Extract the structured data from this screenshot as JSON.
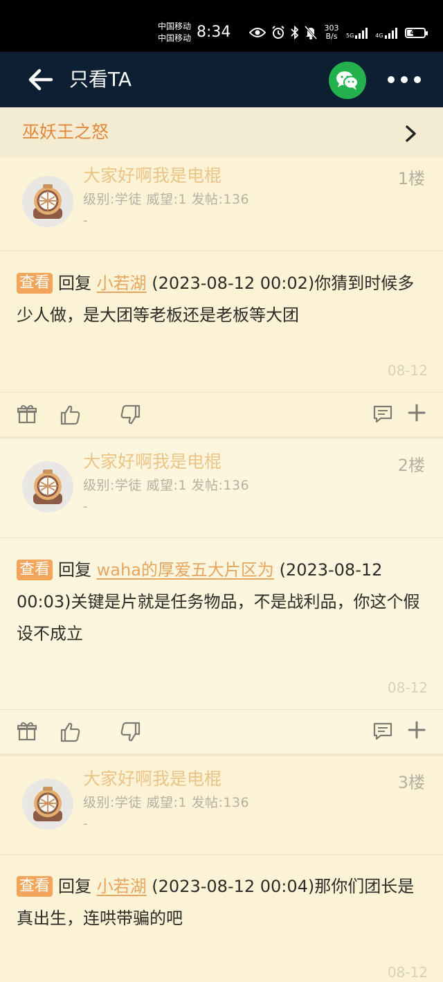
{
  "status_bar": {
    "carrier_1": "中国移动",
    "carrier_2": "中国移动",
    "time": "8:34",
    "net_speed_value": "303",
    "net_speed_unit": "B/s",
    "sim1_label": "5G",
    "sim2_label": "4G",
    "battery_level": "44",
    "battery_fraction": 0.44
  },
  "app_bar": {
    "title": "只看TA"
  },
  "forum": {
    "name": "巫妖王之怒"
  },
  "posts": [
    {
      "author": "大家好啊我是电棍",
      "meta": "级别:学徒 威望:1 发帖:136",
      "dash": "-",
      "floor": "1楼",
      "tag": "查看",
      "reply_prefix": "回复",
      "reply_to": "小若湖",
      "text": "(2023-08-12 00:02)你猜到时候多少人做，是大团等老板还是老板等大团",
      "date": "08-12"
    },
    {
      "author": "大家好啊我是电棍",
      "meta": "级别:学徒 威望:1 发帖:136",
      "dash": "-",
      "floor": "2楼",
      "tag": "查看",
      "reply_prefix": "回复",
      "reply_to": "waha的厚爱五大片区为",
      "text": "(2023-08-12 00:03)关键是片就是任务物品，不是战利品，你这个假设不成立",
      "date": "08-12"
    },
    {
      "author": "大家好啊我是电棍",
      "meta": "级别:学徒 威望:1 发帖:136",
      "dash": "-",
      "floor": "3楼",
      "tag": "查看",
      "reply_prefix": "回复",
      "reply_to": "小若湖",
      "text": "(2023-08-12 00:04)那你们团长是真出生，连哄带骗的吧",
      "date": "08-12"
    }
  ]
}
